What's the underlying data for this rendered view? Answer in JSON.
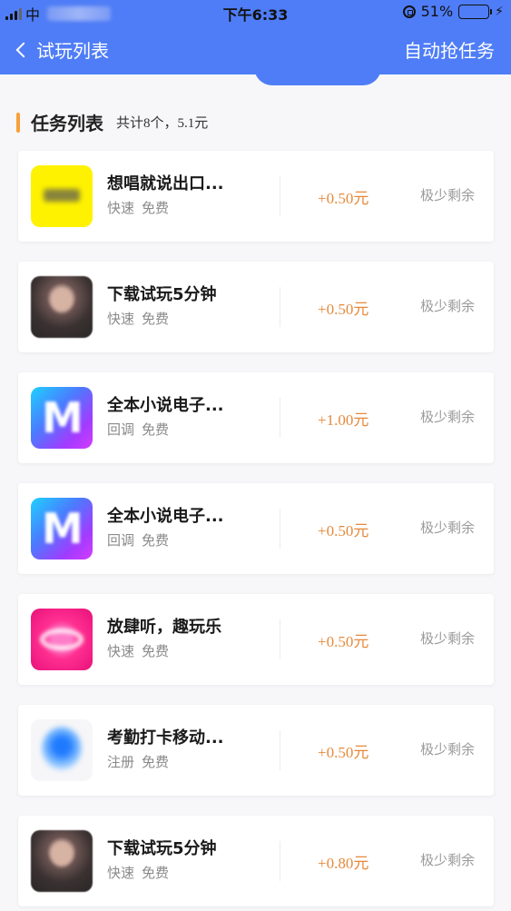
{
  "status_bar": {
    "carrier": "中",
    "time": "下午6:33",
    "battery": "51%",
    "battery_level": 0.51
  },
  "nav": {
    "back_label": "试玩列表",
    "action_label": "自动抢任务"
  },
  "section": {
    "title": "任务列表",
    "summary": "共计8个，5.1元"
  },
  "tasks": [
    {
      "name": "想唱就说出口...",
      "tag1": "快速",
      "tag2": "免费",
      "reward": "+0.50元",
      "stock": "极少剩余",
      "icon": "karaoke-app-icon"
    },
    {
      "name": "下载试玩5分钟",
      "tag1": "快速",
      "tag2": "免费",
      "reward": "+0.50元",
      "stock": "极少剩余",
      "icon": "portrait-app-icon"
    },
    {
      "name": "全本小说电子...",
      "tag1": "回调",
      "tag2": "免费",
      "reward": "+1.00元",
      "stock": "极少剩余",
      "icon": "novel-app-icon"
    },
    {
      "name": "全本小说电子...",
      "tag1": "回调",
      "tag2": "免费",
      "reward": "+0.50元",
      "stock": "极少剩余",
      "icon": "novel-app-icon"
    },
    {
      "name": "放肆听，趣玩乐",
      "tag1": "快速",
      "tag2": "免费",
      "reward": "+0.50元",
      "stock": "极少剩余",
      "icon": "music-app-icon"
    },
    {
      "name": "考勤打卡移动...",
      "tag1": "注册",
      "tag2": "免费",
      "reward": "+0.50元",
      "stock": "极少剩余",
      "icon": "location-app-icon"
    },
    {
      "name": "下载试玩5分钟",
      "tag1": "快速",
      "tag2": "免费",
      "reward": "+0.80元",
      "stock": "极少剩余",
      "icon": "portrait-app-icon"
    }
  ],
  "colors": {
    "primary": "#4f7df7",
    "accent": "#f5a03a",
    "reward": "#e58a3c"
  }
}
